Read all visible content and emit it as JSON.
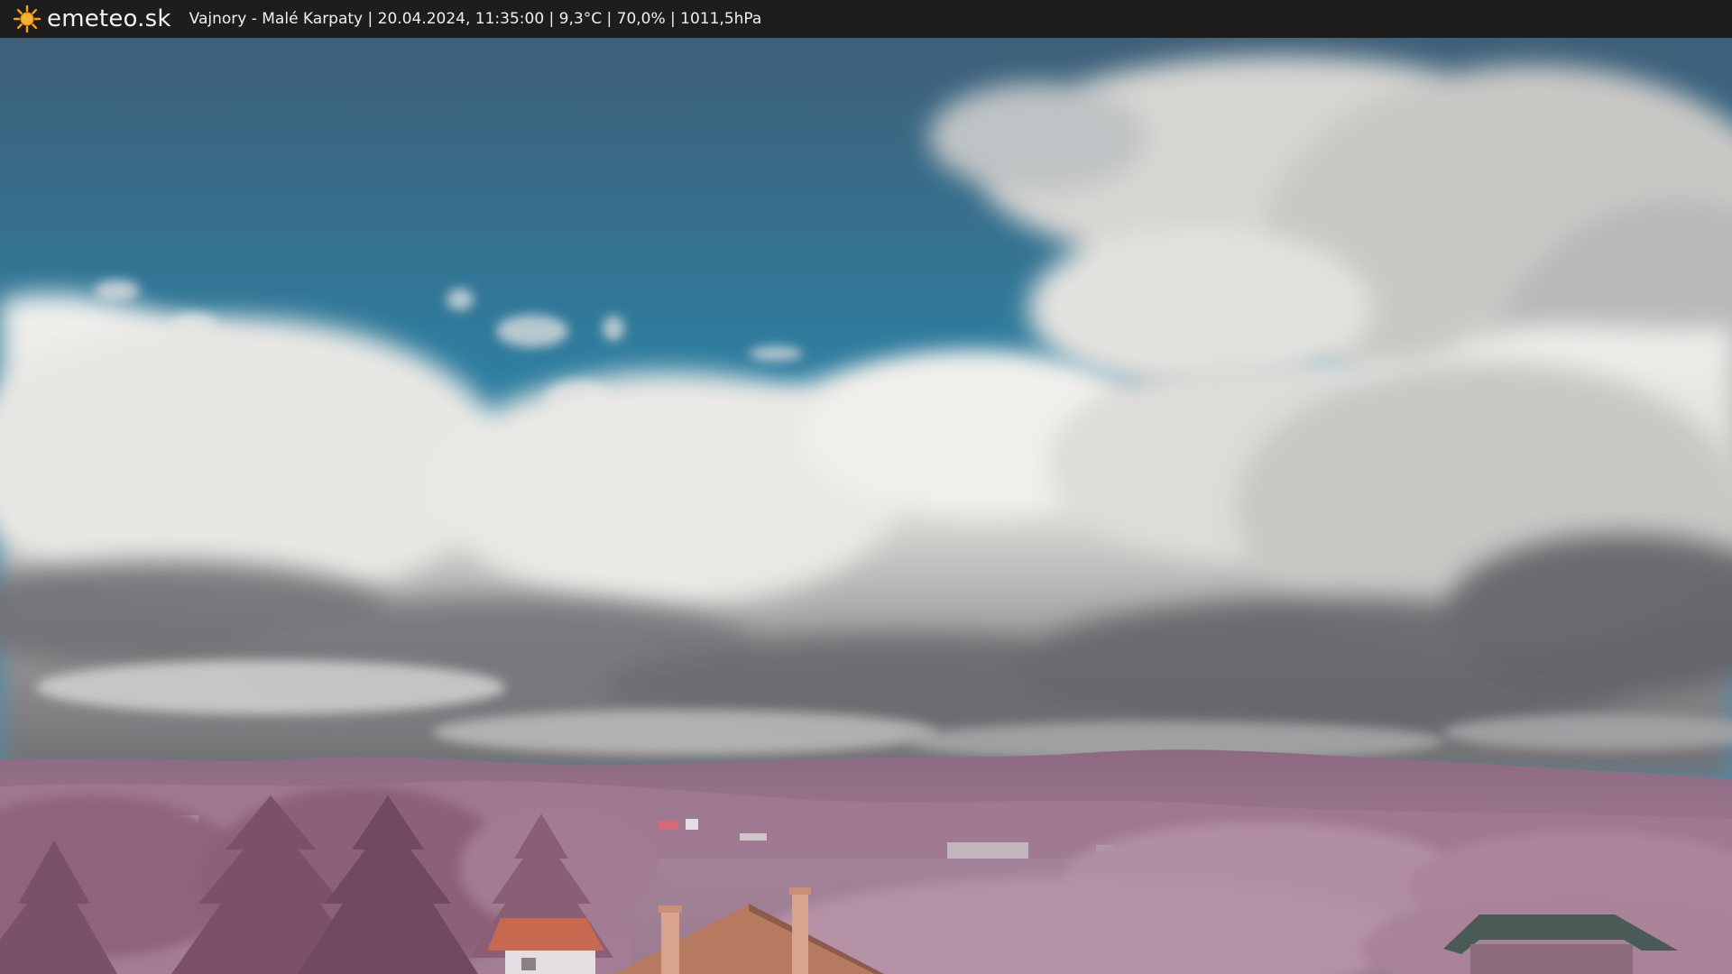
{
  "header": {
    "brand": "emeteo.sk",
    "station_info": "Vajnory - Malé Karpaty | 20.04.2024, 11:35:00 | 9,3°C | 70,0% | 1011,5hPa",
    "brand_icon": "sun-icon"
  },
  "colors": {
    "bar_background": "#1d1d1d",
    "sky": "#2f7e9e",
    "cloud": "#e8e6e3",
    "hills": "#9a6f8a",
    "foliage": "#b28a9e"
  }
}
